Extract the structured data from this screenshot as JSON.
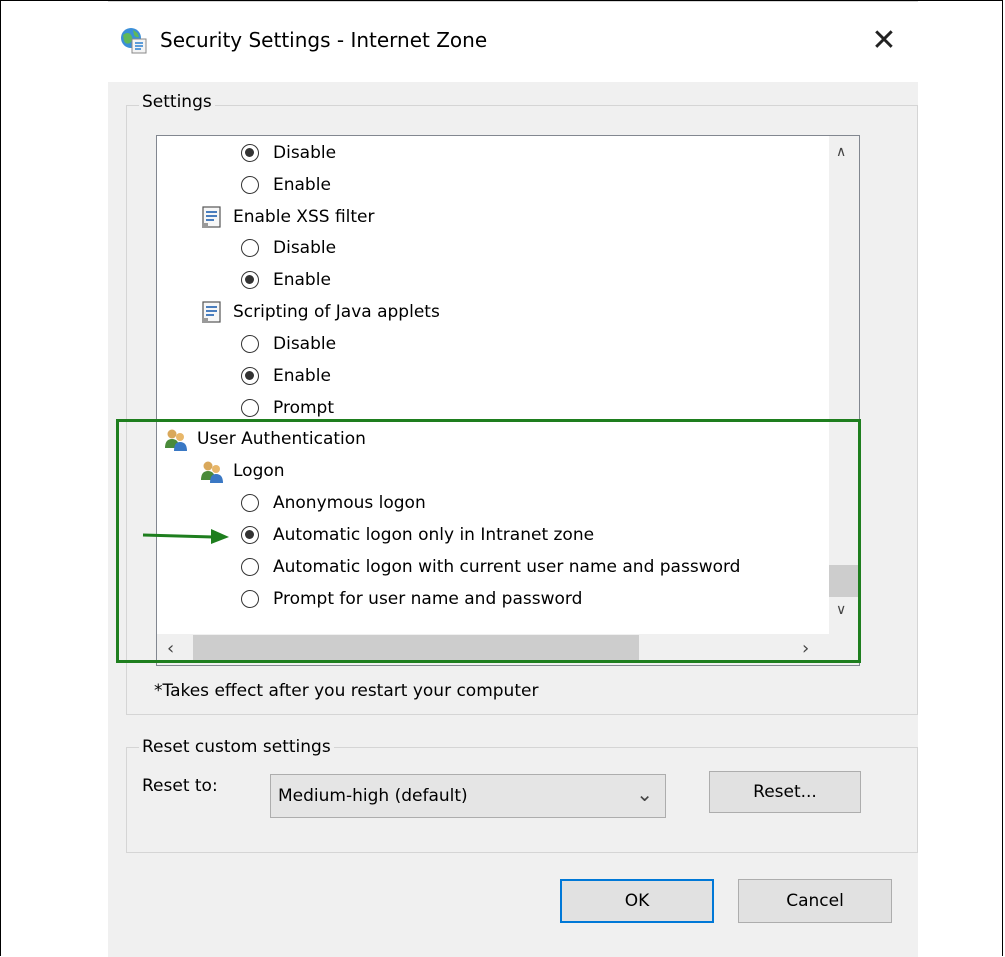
{
  "window": {
    "title": "Security Settings - Internet Zone",
    "close_glyph": "✕"
  },
  "settings_group": {
    "label": "Settings",
    "items": [
      {
        "kind": "radio",
        "label": "Disable",
        "checked": true
      },
      {
        "kind": "radio",
        "label": "Enable",
        "checked": false
      },
      {
        "kind": "category",
        "label": "Enable XSS filter",
        "icon": "script-icon"
      },
      {
        "kind": "radio",
        "label": "Disable",
        "checked": false
      },
      {
        "kind": "radio",
        "label": "Enable",
        "checked": true
      },
      {
        "kind": "category",
        "label": "Scripting of Java applets",
        "icon": "script-icon"
      },
      {
        "kind": "radio",
        "label": "Disable",
        "checked": false
      },
      {
        "kind": "radio",
        "label": "Enable",
        "checked": true
      },
      {
        "kind": "radio",
        "label": "Prompt",
        "checked": false
      },
      {
        "kind": "category",
        "label": "User Authentication",
        "icon": "users-icon"
      },
      {
        "kind": "category",
        "label": "Logon",
        "icon": "users-icon"
      },
      {
        "kind": "radio",
        "label": "Anonymous logon",
        "checked": false
      },
      {
        "kind": "radio",
        "label": "Automatic logon only in Intranet zone",
        "checked": true
      },
      {
        "kind": "radio",
        "label": "Automatic logon with current user name and password",
        "checked": false
      },
      {
        "kind": "radio",
        "label": "Prompt for user name and password",
        "checked": false
      }
    ],
    "footnote": "*Takes effect after you restart your computer"
  },
  "reset_group": {
    "label": "Reset custom settings",
    "reset_to_label": "Reset to:",
    "selected_level": "Medium-high (default)",
    "reset_button": "Reset..."
  },
  "buttons": {
    "ok": "OK",
    "cancel": "Cancel"
  },
  "annotation": {
    "highlight_color": "#1e7e1e"
  }
}
